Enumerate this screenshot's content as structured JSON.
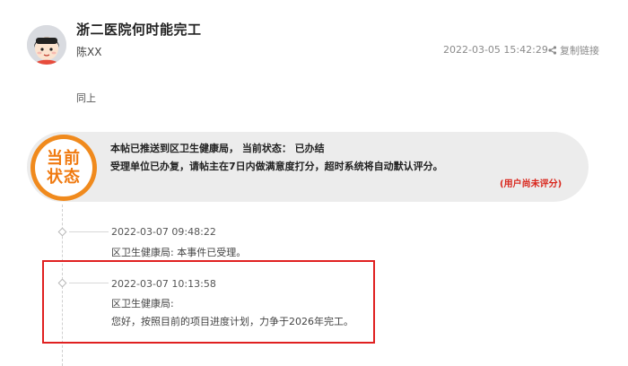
{
  "post": {
    "title": "浙二医院何时能完工",
    "author": "陈XX",
    "timestamp": "2022-03-05 15:42:29",
    "copy_link_label": "复制链接",
    "content": "同上"
  },
  "status": {
    "badge_line1": "当前",
    "badge_line2": "状态",
    "line1": "本帖已推送到区卫生健康局， 当前状态： 已办结",
    "line2": "受理单位已办复，请帖主在7日内做满意度打分，超时系统将自动默认评分。",
    "rating_note": "(用户尚未评分)"
  },
  "timeline": [
    {
      "time": "2022-03-07 09:48:22",
      "text": "区卫生健康局: 本事件已受理。"
    },
    {
      "time": "2022-03-07 10:13:58",
      "text": "区卫生健康局:",
      "reply": "您好，按照目前的项目进度计划，力争于2026年完工。"
    }
  ],
  "colors": {
    "accent_orange": "#f08a1d",
    "highlight_red": "#e02020",
    "rating_red": "#d9261c",
    "panel_gray": "#ececec"
  },
  "icons": {
    "avatar": "avatar",
    "share": "share-icon"
  }
}
